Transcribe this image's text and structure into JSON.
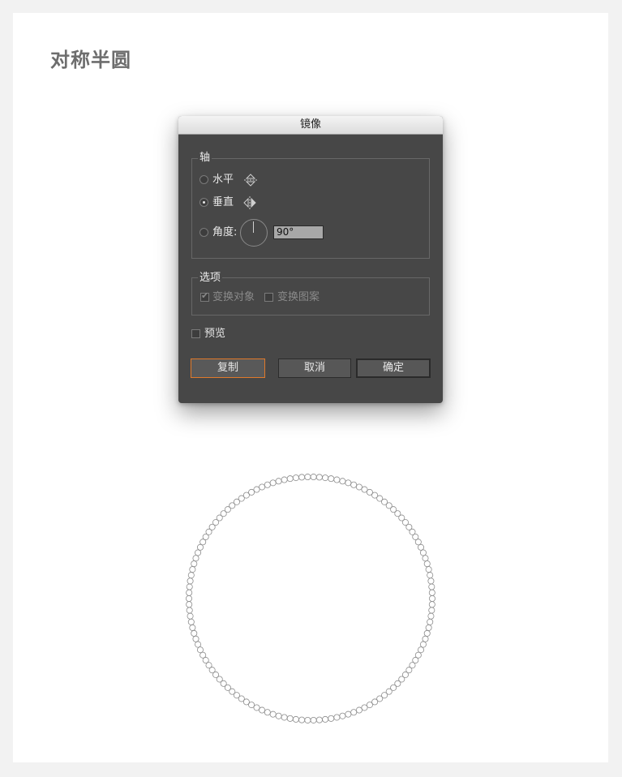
{
  "page": {
    "title": "对称半圆"
  },
  "dialog": {
    "title": "镜像",
    "axis_group": {
      "legend": "轴",
      "horizontal_label": "水平",
      "vertical_label": "垂直",
      "angle_label": "角度:",
      "angle_value": "90°",
      "selected": "vertical"
    },
    "options_group": {
      "legend": "选项",
      "transform_objects_label": "变换对象",
      "transform_patterns_label": "变换图案"
    },
    "preview_label": "预览",
    "buttons": {
      "copy": "复制",
      "cancel": "取消",
      "ok": "确定"
    }
  },
  "icons": [
    "reflect-horizontal-icon",
    "reflect-vertical-icon",
    "angle-dial-icon"
  ],
  "colors": {
    "dialog_bg": "#474747",
    "focus_ring": "#e0792a",
    "title_text": "#6d6d6d"
  }
}
